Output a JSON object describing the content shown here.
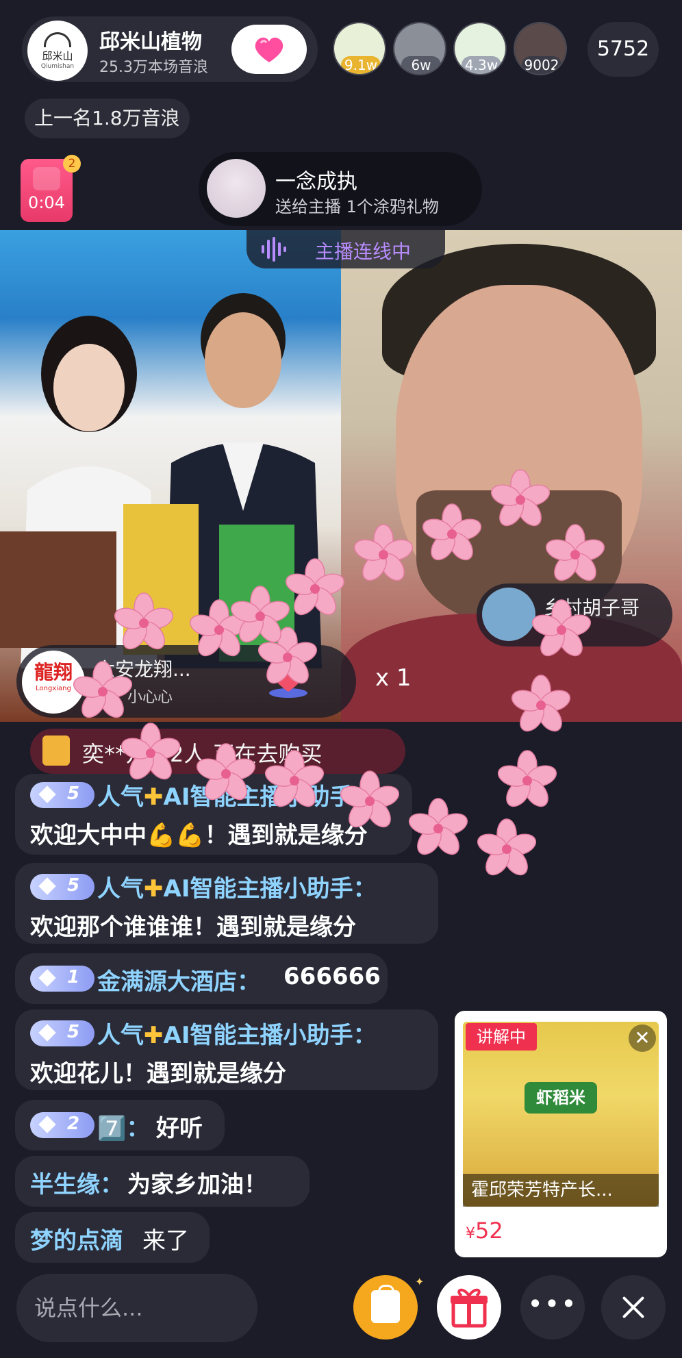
{
  "header": {
    "host_name": "邱米山植物",
    "host_sub": "25.3万本场音浪",
    "avatar_text": "邱米山",
    "avatar_en": "Qiumishan",
    "viewers": [
      {
        "badge": "9.1w",
        "bg": "#e9f0d8",
        "badge_color": "#e9b430"
      },
      {
        "badge": "6w",
        "bg": "#8a8f98",
        "badge_color": "#555a66"
      },
      {
        "badge": "4.3w",
        "bg": "#e6f2e0",
        "badge_color": "#a0a7b3"
      },
      {
        "badge": "9002",
        "bg": "#5a4a4a",
        "badge_color": "#3a3b46"
      }
    ],
    "viewer_count": "5752"
  },
  "rank_text": "上一名1.8万音浪",
  "timer": {
    "time": "0:04",
    "badge": "2"
  },
  "gift_toast": {
    "user": "一念成执",
    "text": "送给主播 1个涂鸦礼物"
  },
  "connect_text": "主播连线中",
  "guest_left": {
    "name": "六安龙翔...",
    "sub": "小心心",
    "logo_cn": "龍翔",
    "logo_en": "Longxiang"
  },
  "guest_right": {
    "name": "乡村胡子哥"
  },
  "multiplier": "x 1",
  "buy_text": "奕**儿等2人 正在去购买",
  "chat": [
    {
      "level": "5",
      "user": "人气",
      "user_suffix": "AI智能主播小助手：",
      "message": "欢迎大中中💪💪！遇到就是缘分"
    },
    {
      "level": "5",
      "user": "人气",
      "user_suffix": "AI智能主播小助手：",
      "message": "欢迎那个谁谁谁！遇到就是缘分"
    },
    {
      "level": "1",
      "user": "金满源大酒店：",
      "message": "666666"
    },
    {
      "level": "5",
      "user": "人气",
      "user_suffix": "AI智能主播小助手：",
      "message": "欢迎花儿！遇到就是缘分"
    },
    {
      "level": "2",
      "user": "7️⃣：",
      "message": "好听"
    },
    {
      "user": "半生缘：",
      "message": "为家乡加油！"
    },
    {
      "user": "梦的点滴",
      "message": "来了"
    }
  ],
  "product": {
    "tag": "讲解中",
    "close": "✕",
    "label": "虾稻米",
    "title": "霍邱荣芳特产长...",
    "currency": "¥",
    "price": "52"
  },
  "bottom": {
    "placeholder": "说点什么...",
    "more": "•••"
  },
  "colors": {
    "accent_pink": "#f0304f",
    "chat_name": "#8fd3ff",
    "connect": "#b88cff"
  }
}
